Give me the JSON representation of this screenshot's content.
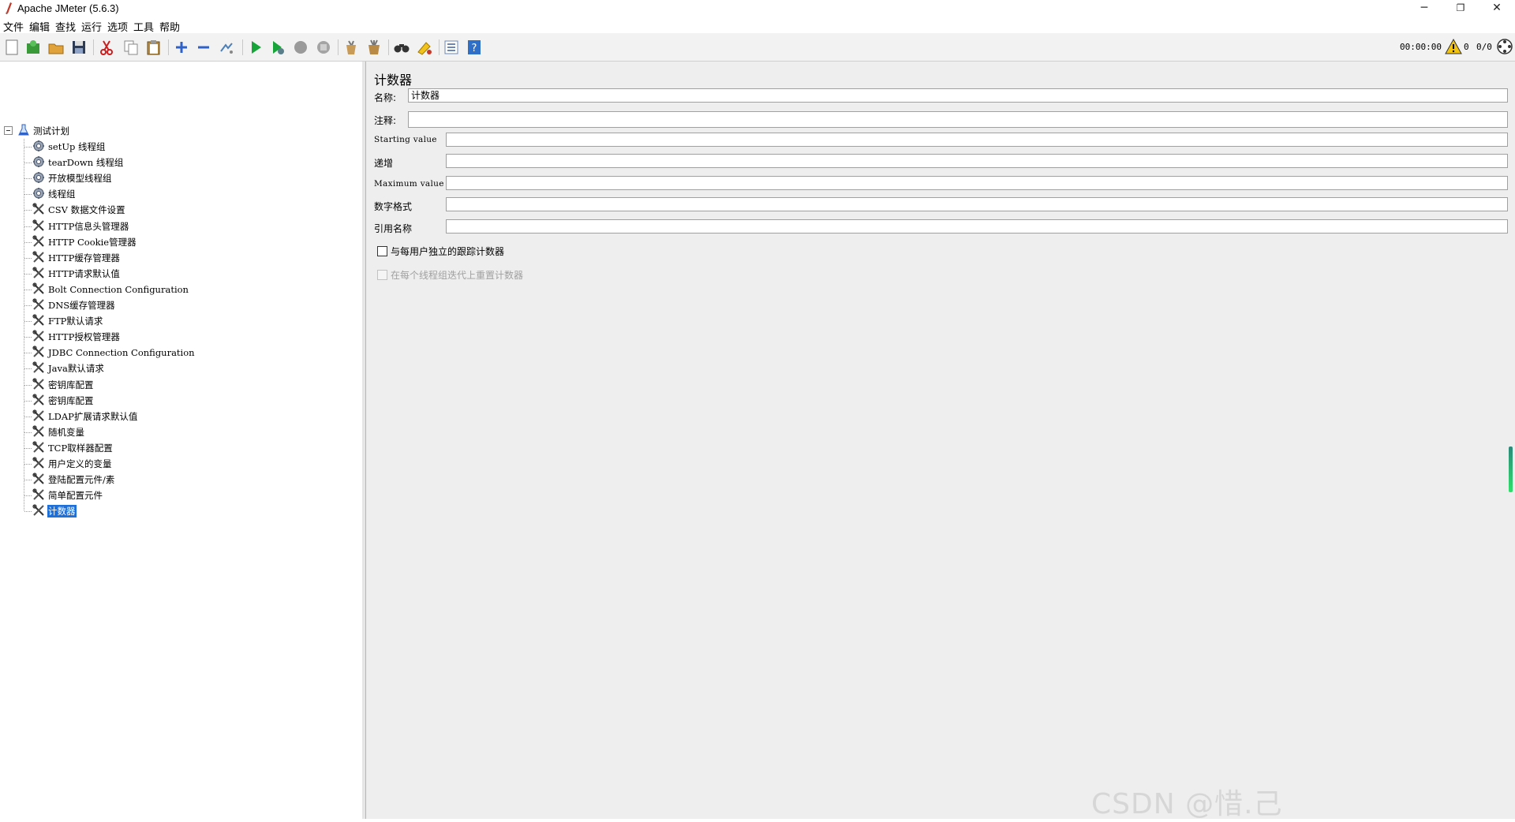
{
  "window": {
    "title": "Apache JMeter (5.6.3)",
    "minimize": "─",
    "restore": "❐",
    "close": "✕"
  },
  "menu": [
    "文件",
    "编辑",
    "查找",
    "运行",
    "选项",
    "工具",
    "帮助"
  ],
  "toolbar": {
    "timer": "00:00:00",
    "warning_count": "0",
    "threads": "0/0"
  },
  "tree": {
    "root": "测试计划",
    "items": [
      {
        "label": "setUp 线程组",
        "icon": "gear-icon"
      },
      {
        "label": "tearDown 线程组",
        "icon": "gear-icon"
      },
      {
        "label": "开放模型线程组",
        "icon": "gear-icon"
      },
      {
        "label": "线程组",
        "icon": "gear-icon"
      },
      {
        "label": "CSV 数据文件设置",
        "icon": "wrench-icon"
      },
      {
        "label": "HTTP信息头管理器",
        "icon": "wrench-icon"
      },
      {
        "label": "HTTP Cookie管理器",
        "icon": "wrench-icon"
      },
      {
        "label": "HTTP缓存管理器",
        "icon": "wrench-icon"
      },
      {
        "label": "HTTP请求默认值",
        "icon": "wrench-icon"
      },
      {
        "label": "Bolt Connection Configuration",
        "icon": "wrench-icon"
      },
      {
        "label": "DNS缓存管理器",
        "icon": "wrench-icon"
      },
      {
        "label": "FTP默认请求",
        "icon": "wrench-icon"
      },
      {
        "label": "HTTP授权管理器",
        "icon": "wrench-icon"
      },
      {
        "label": "JDBC Connection Configuration",
        "icon": "wrench-icon"
      },
      {
        "label": "Java默认请求",
        "icon": "wrench-icon"
      },
      {
        "label": "密钥库配置",
        "icon": "wrench-icon"
      },
      {
        "label": "密钥库配置",
        "icon": "wrench-icon"
      },
      {
        "label": "LDAP扩展请求默认值",
        "icon": "wrench-icon"
      },
      {
        "label": "随机变量",
        "icon": "wrench-icon"
      },
      {
        "label": "TCP取样器配置",
        "icon": "wrench-icon"
      },
      {
        "label": "用户定义的变量",
        "icon": "wrench-icon"
      },
      {
        "label": "登陆配置元件/素",
        "icon": "wrench-icon"
      },
      {
        "label": "简单配置元件",
        "icon": "wrench-icon"
      },
      {
        "label": "计数器",
        "icon": "wrench-icon",
        "selected": true
      }
    ]
  },
  "panel": {
    "title": "计数器",
    "name_label": "名称:",
    "name_value": "计数器",
    "comment_label": "注释:",
    "comment_value": "",
    "starting_label": "Starting value",
    "starting_value": "",
    "increment_label": "递增",
    "increment_value": "",
    "maximum_label": "Maximum value",
    "maximum_value": "",
    "format_label": "数字格式",
    "format_value": "",
    "refname_label": "引用名称",
    "refname_value": "",
    "per_user_label": "与每用户独立的跟踪计数器",
    "reset_label": "在每个线程组迭代上重置计数器"
  },
  "watermark": "CSDN @惜.己"
}
